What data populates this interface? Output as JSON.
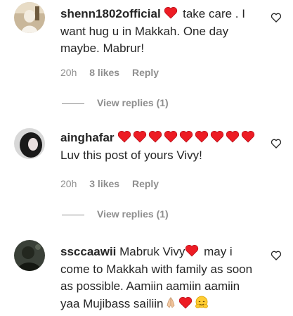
{
  "colors": {
    "heart": "#ed1c24",
    "meta": "#8e8e8e",
    "text": "#262626"
  },
  "comments": [
    {
      "username": "shenn1802official",
      "text": " take care . I want hug u in Makkah. One day maybe. Mabrur!",
      "time": "20h",
      "likes": "8 likes",
      "reply": "Reply",
      "view_replies": "View replies (1)",
      "avatar_icon": "woman-in-white-hijab-avatar"
    },
    {
      "username": "ainghafar",
      "text": " Luv this post of yours Vivy!",
      "time": "20h",
      "likes": "3 likes",
      "reply": "Reply",
      "view_replies": "View replies (1)",
      "avatar_icon": "woman-dark-photo-avatar"
    },
    {
      "username": "ssccaawii",
      "text_a": "Mabruk Vivy",
      "text_b": " may i come to Makkah with family as soon as possible. Aamiin aamiin aamiin yaa Mujibass sailiin",
      "avatar_icon": "dark-green-photo-avatar"
    }
  ]
}
